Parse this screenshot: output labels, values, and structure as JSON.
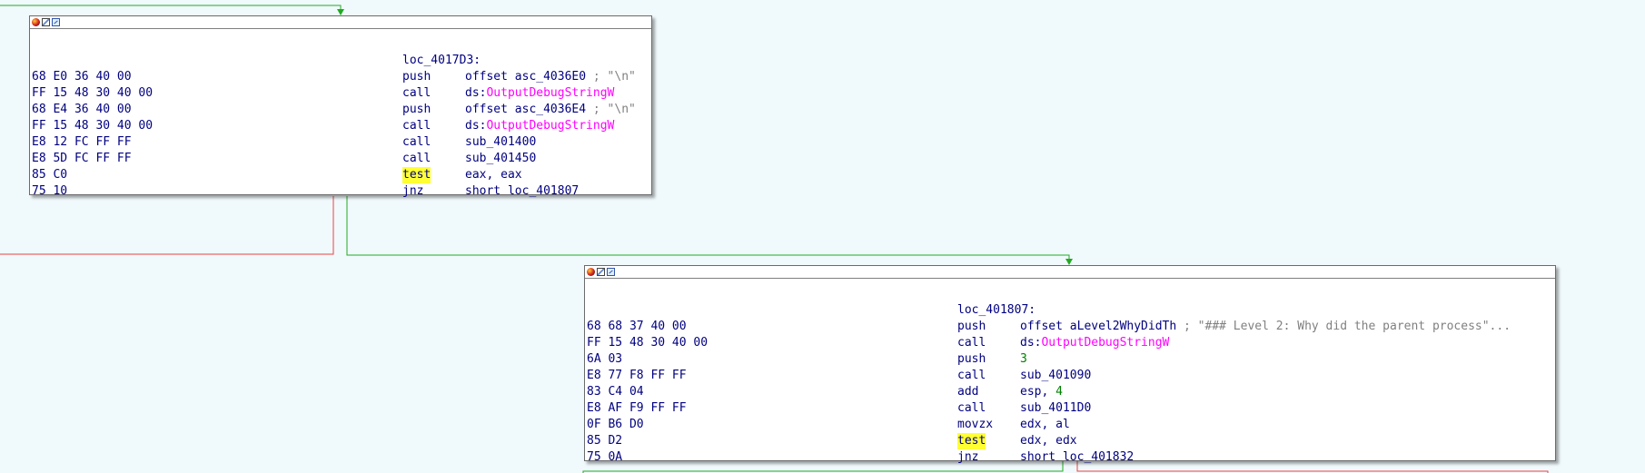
{
  "colors": {
    "background": "#f0f9fc",
    "edge_true": "#22aa22",
    "edge_false": "#ee4444",
    "text": "#000080",
    "import": "#ff00ff",
    "immediate": "#008000",
    "comment": "#808080",
    "highlight": "#ffff33"
  },
  "header_icons": [
    "color-icon",
    "rename-icon",
    "graph-icon"
  ],
  "block1": {
    "label": "loc_4017D3:",
    "lines": [
      {
        "bytes": "68 E0 36 40 00",
        "mnem": "push",
        "op": "offset asc_4036E0",
        "op_imp": "",
        "op_num": "",
        "comment": " ; \"\\n\""
      },
      {
        "bytes": "FF 15 48 30 40 00",
        "mnem": "call",
        "op": "ds:",
        "op_imp": "OutputDebugStringW",
        "op_num": "",
        "comment": ""
      },
      {
        "bytes": "68 E4 36 40 00",
        "mnem": "push",
        "op": "offset asc_4036E4",
        "op_imp": "",
        "op_num": "",
        "comment": " ; \"\\n\""
      },
      {
        "bytes": "FF 15 48 30 40 00",
        "mnem": "call",
        "op": "ds:",
        "op_imp": "OutputDebugStringW",
        "op_num": "",
        "comment": ""
      },
      {
        "bytes": "E8 12 FC FF FF",
        "mnem": "call",
        "op": "sub_401400",
        "op_imp": "",
        "op_num": "",
        "comment": ""
      },
      {
        "bytes": "E8 5D FC FF FF",
        "mnem": "call",
        "op": "sub_401450",
        "op_imp": "",
        "op_num": "",
        "comment": ""
      },
      {
        "bytes": "85 C0",
        "mnem": "test",
        "highlight": true,
        "op": "eax, eax",
        "op_imp": "",
        "op_num": "",
        "comment": ""
      },
      {
        "bytes": "75 10",
        "mnem": "jnz",
        "op": "short loc_401807",
        "op_imp": "",
        "op_num": "",
        "comment": ""
      }
    ]
  },
  "block2": {
    "label": "loc_401807:",
    "lines": [
      {
        "bytes": "68 68 37 40 00",
        "mnem": "push",
        "op": "offset aLevel2WhyDidTh",
        "op_imp": "",
        "op_num": "",
        "comment": " ; \"### Level 2: Why did the parent process\"..."
      },
      {
        "bytes": "FF 15 48 30 40 00",
        "mnem": "call",
        "op": "ds:",
        "op_imp": "OutputDebugStringW",
        "op_num": "",
        "comment": ""
      },
      {
        "bytes": "6A 03",
        "mnem": "push",
        "op": "",
        "op_imp": "",
        "op_num": "3",
        "comment": ""
      },
      {
        "bytes": "E8 77 F8 FF FF",
        "mnem": "call",
        "op": "sub_401090",
        "op_imp": "",
        "op_num": "",
        "comment": ""
      },
      {
        "bytes": "83 C4 04",
        "mnem": "add",
        "op": "esp, ",
        "op_imp": "",
        "op_num": "4",
        "comment": ""
      },
      {
        "bytes": "E8 AF F9 FF FF",
        "mnem": "call",
        "op": "sub_4011D0",
        "op_imp": "",
        "op_num": "",
        "comment": ""
      },
      {
        "bytes": "0F B6 D0",
        "mnem": "movzx",
        "op": "edx, al",
        "op_imp": "",
        "op_num": "",
        "comment": ""
      },
      {
        "bytes": "85 D2",
        "mnem": "test",
        "highlight": true,
        "op": "edx, edx",
        "op_imp": "",
        "op_num": "",
        "comment": ""
      },
      {
        "bytes": "75 0A",
        "mnem": "jnz",
        "op": "short loc_401832",
        "op_imp": "",
        "op_num": "",
        "comment": ""
      }
    ]
  }
}
